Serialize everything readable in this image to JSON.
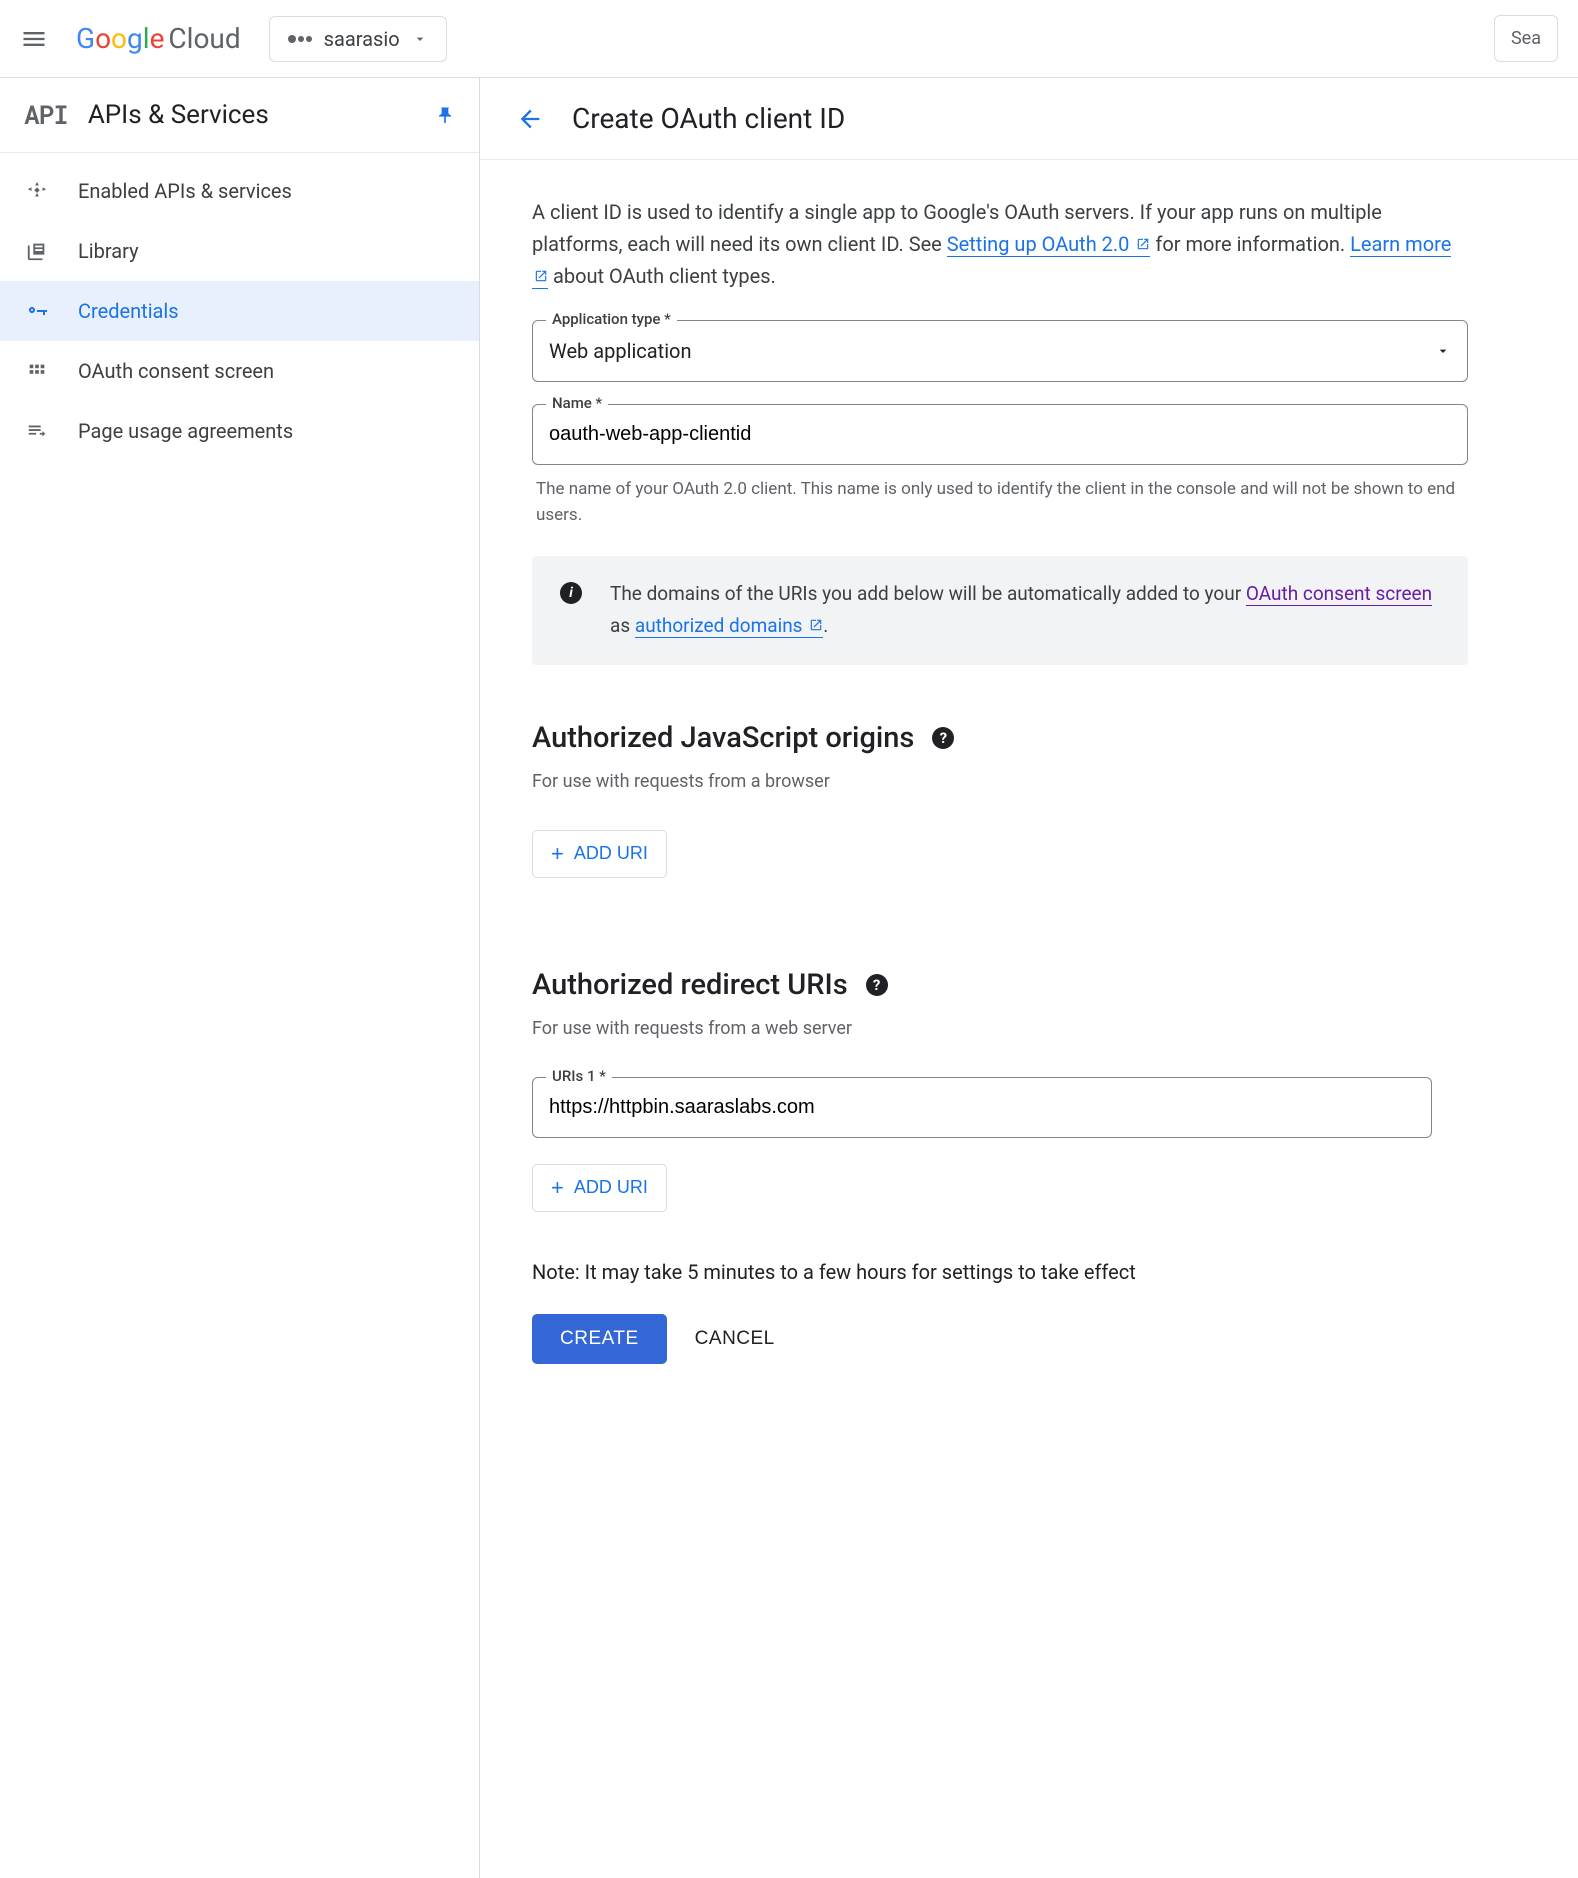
{
  "header": {
    "logo_text": "Cloud",
    "project": "saarasio",
    "search_placeholder": "Sea"
  },
  "sidebar": {
    "api_badge": "API",
    "title": "APIs & Services",
    "items": [
      {
        "label": "Enabled APIs & services",
        "icon": "enabled-apis-icon"
      },
      {
        "label": "Library",
        "icon": "library-icon"
      },
      {
        "label": "Credentials",
        "icon": "key-icon",
        "active": true
      },
      {
        "label": "OAuth consent screen",
        "icon": "consent-icon"
      },
      {
        "label": "Page usage agreements",
        "icon": "agreements-icon"
      }
    ]
  },
  "main": {
    "title": "Create OAuth client ID",
    "intro": {
      "text1": "A client ID is used to identify a single app to Google's OAuth servers. If your app runs on multiple platforms, each will need its own client ID. See ",
      "link1": "Setting up OAuth 2.0",
      "text2": " for more information. ",
      "link2": "Learn more",
      "text3": " about OAuth client types."
    },
    "app_type": {
      "label": "Application type *",
      "value": "Web application"
    },
    "name_field": {
      "label": "Name *",
      "value": "oauth-web-app-clientid",
      "helper": "The name of your OAuth 2.0 client. This name is only used to identify the client in the console and will not be shown to end users."
    },
    "info_box": {
      "text1": "The domains of the URIs you add below will be automatically added to your ",
      "link1": "OAuth consent screen",
      "text2": " as ",
      "link2": "authorized domains",
      "text3": "."
    },
    "js_origins": {
      "title": "Authorized JavaScript origins",
      "desc": "For use with requests from a browser",
      "add_btn": "ADD URI"
    },
    "redirect_uris": {
      "title": "Authorized redirect URIs",
      "desc": "For use with requests from a web server",
      "field_label": "URIs 1 *",
      "field_value": "https://httpbin.saaraslabs.com",
      "add_btn": "ADD URI"
    },
    "note": "Note: It may take 5 minutes to a few hours for settings to take effect",
    "actions": {
      "create": "CREATE",
      "cancel": "CANCEL"
    }
  }
}
